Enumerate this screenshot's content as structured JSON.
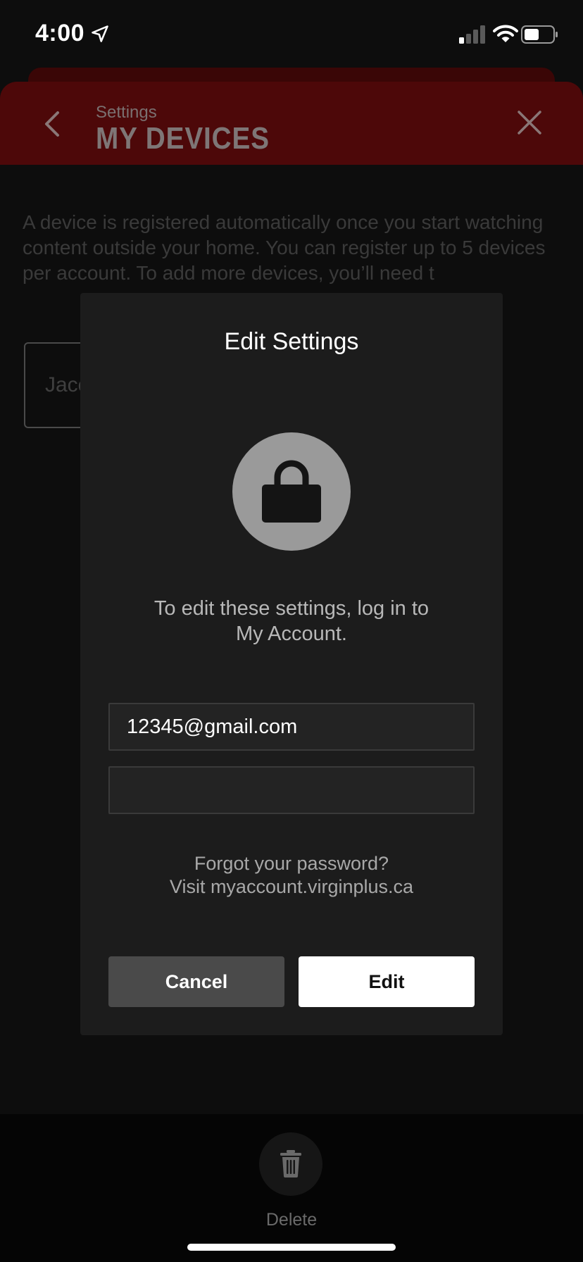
{
  "status_bar": {
    "time": "4:00"
  },
  "header": {
    "subtitle": "Settings",
    "title": "MY DEVICES"
  },
  "content": {
    "description": "A device is registered automatically once you start watching content outside your home. You can register up to 5 devices per account. To add more devices, you’ll need t",
    "device_name": "Jaco"
  },
  "modal": {
    "title": "Edit Settings",
    "message_line1": "To edit these settings, log in to",
    "message_line2": "My Account.",
    "email_value": "12345@gmail.com",
    "password_value": "",
    "forgot_line1": "Forgot your password?",
    "forgot_line2": "Visit myaccount.virginplus.ca",
    "cancel_label": "Cancel",
    "edit_label": "Edit"
  },
  "bottom": {
    "delete_label": "Delete"
  },
  "colors": {
    "header_bg": "#4d0809",
    "modal_bg": "#1c1c1c",
    "primary_button": "#ffffff",
    "secondary_button": "#4a4a4a"
  },
  "icons": {
    "location": "location-arrow-icon",
    "signal": "cellular-signal-icon",
    "wifi": "wifi-icon",
    "battery": "battery-icon",
    "back": "chevron-left-icon",
    "close": "close-icon",
    "lock": "lock-icon",
    "delete": "trash-icon"
  }
}
